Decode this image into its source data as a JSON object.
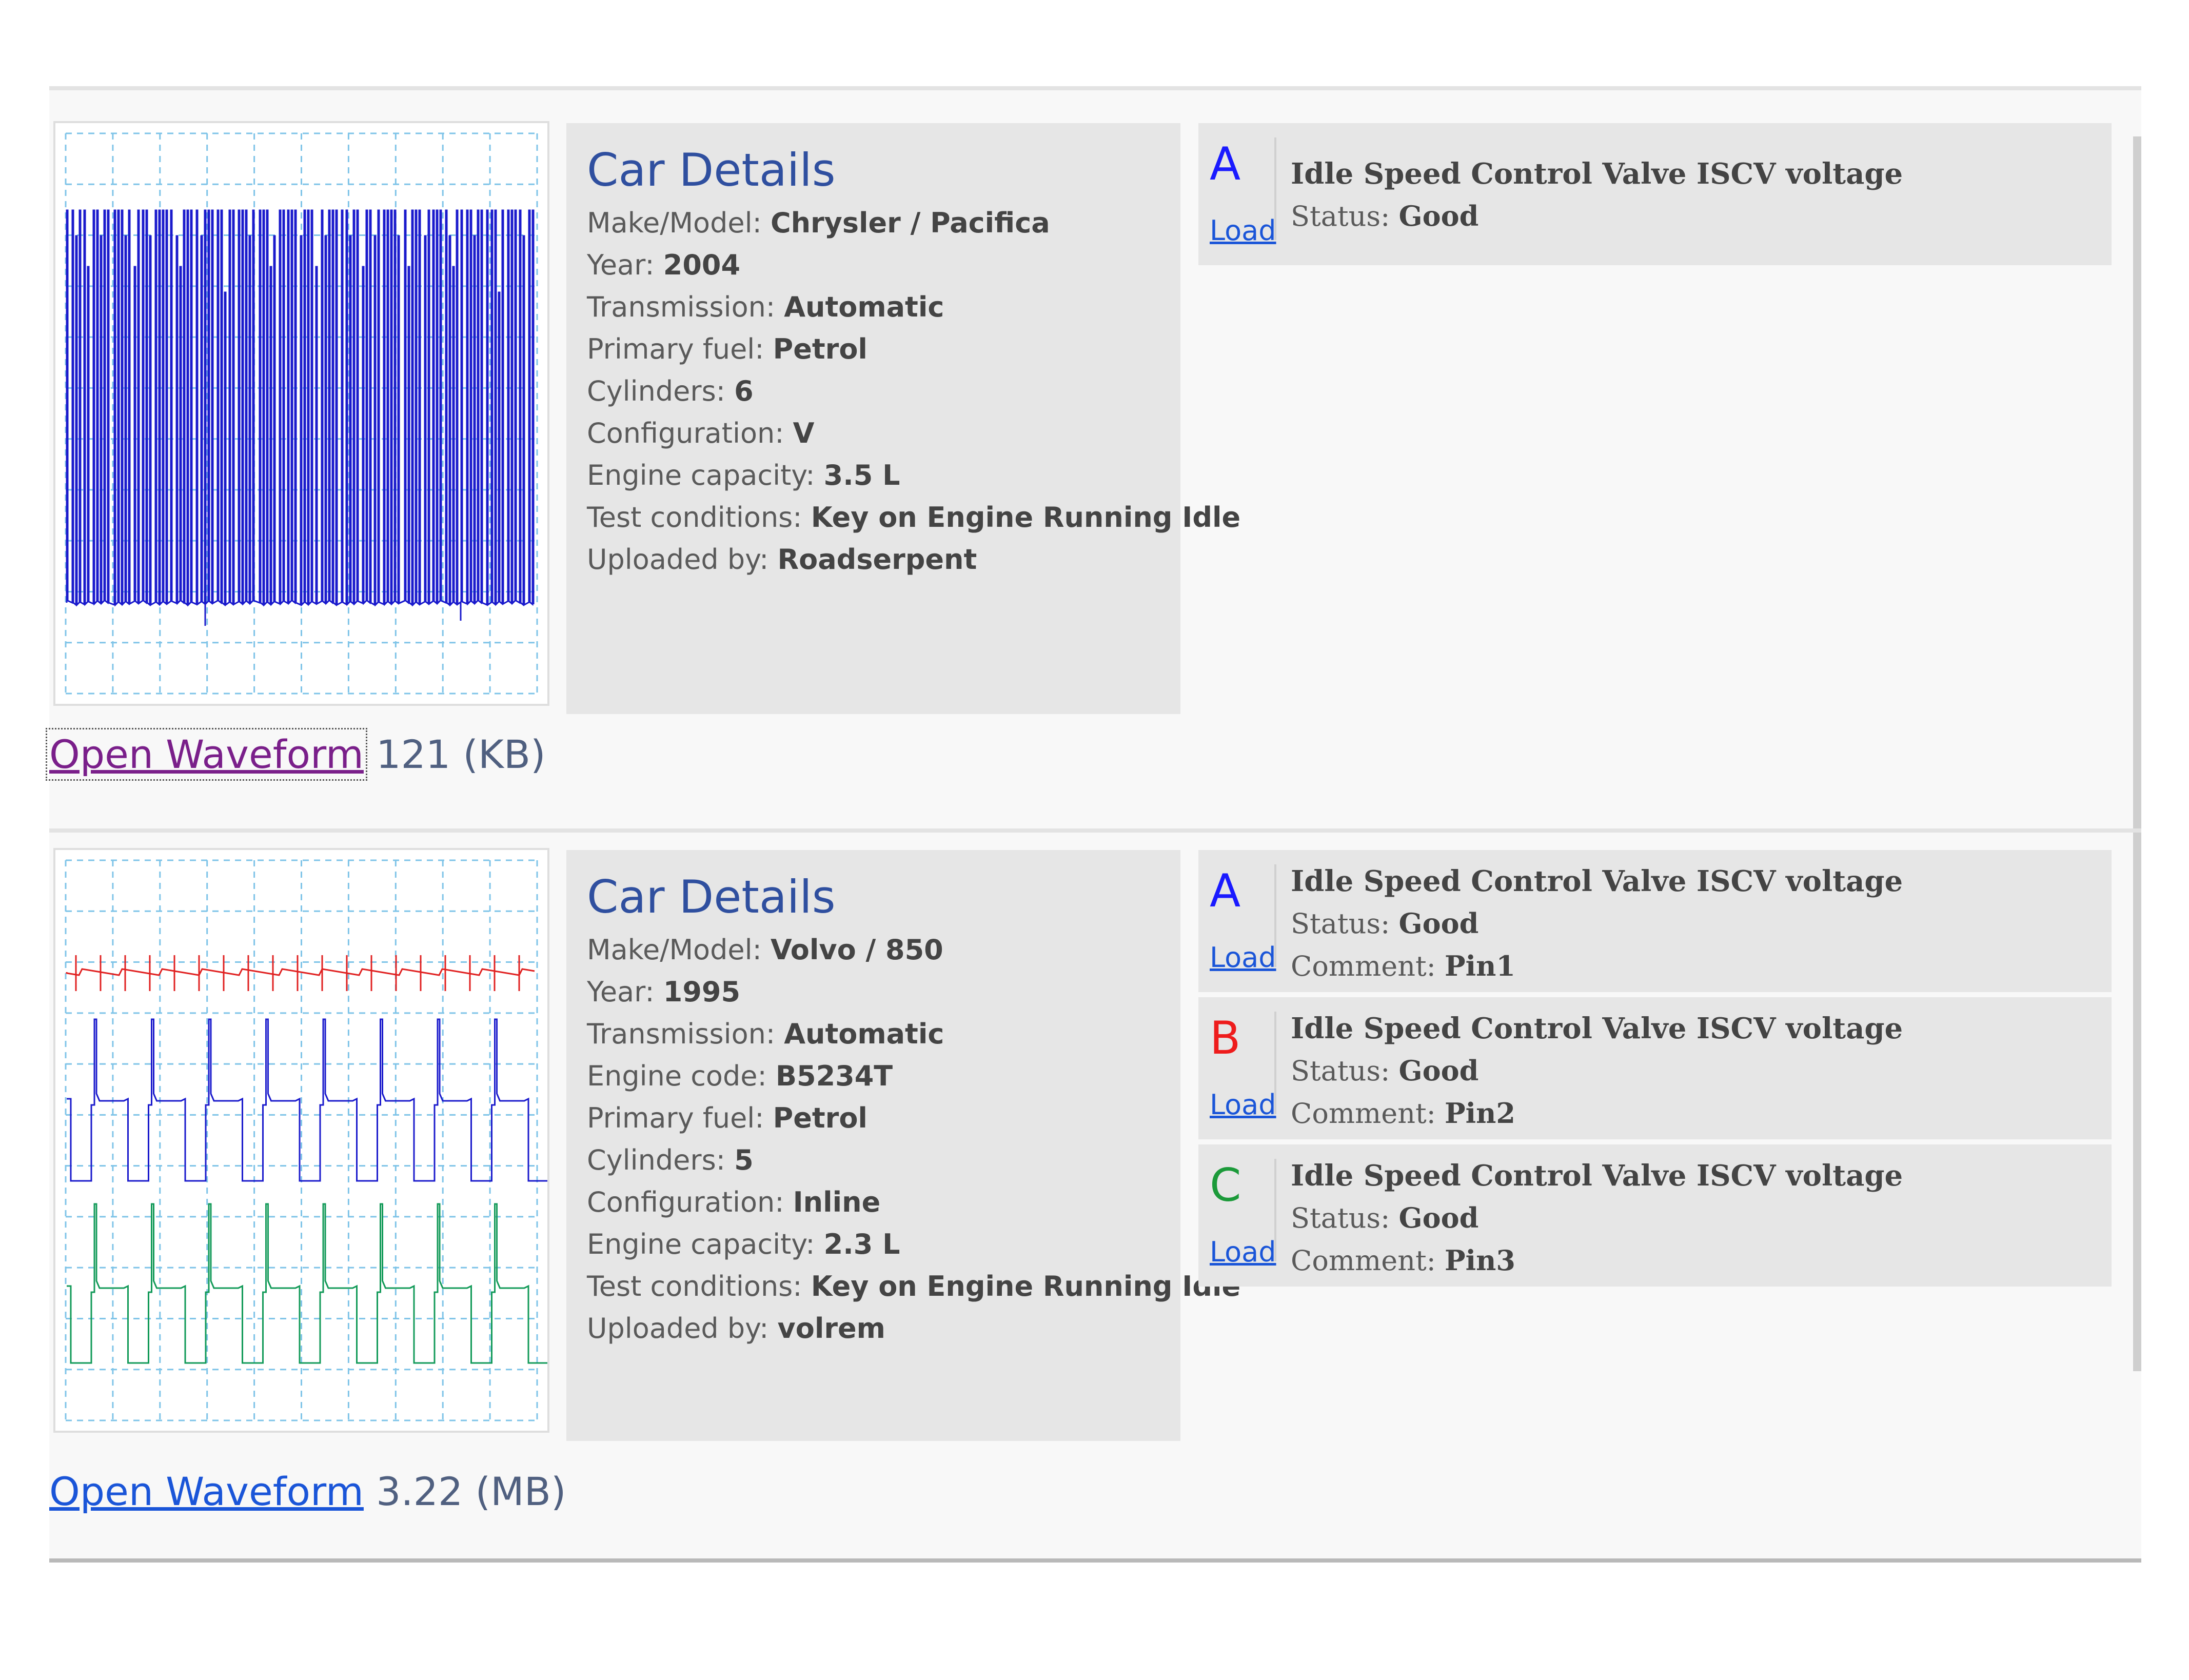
{
  "records": [
    {
      "details_title": "Car Details",
      "fields": [
        {
          "label": "Make/Model:",
          "value": "Chrysler / Pacifica"
        },
        {
          "label": "Year:",
          "value": "2004"
        },
        {
          "label": "Transmission:",
          "value": "Automatic"
        },
        {
          "label": "Primary fuel:",
          "value": "Petrol"
        },
        {
          "label": "Cylinders:",
          "value": "6"
        },
        {
          "label": "Configuration:",
          "value": "V"
        },
        {
          "label": "Engine capacity:",
          "value": "3.5 L"
        },
        {
          "label": "Test conditions:",
          "value": "Key on Engine Running Idle"
        },
        {
          "label": "Uploaded by:",
          "value": "Roadserpent"
        }
      ],
      "channels": [
        {
          "letter": "A",
          "color": "#1a1aff",
          "title": "Idle Speed Control Valve ISCV voltage",
          "status_label": "Status:",
          "status": "Good",
          "load_label": "Load"
        }
      ],
      "open_waveform_label": "Open Waveform",
      "file_size": "121 (KB)",
      "link_color": "#7a1f8a"
    },
    {
      "details_title": "Car Details",
      "fields": [
        {
          "label": "Make/Model:",
          "value": "Volvo / 850"
        },
        {
          "label": "Year:",
          "value": "1995"
        },
        {
          "label": "Transmission:",
          "value": "Automatic"
        },
        {
          "label": "Engine code:",
          "value": "B5234T"
        },
        {
          "label": "Primary fuel:",
          "value": "Petrol"
        },
        {
          "label": "Cylinders:",
          "value": "5"
        },
        {
          "label": "Configuration:",
          "value": "Inline"
        },
        {
          "label": "Engine capacity:",
          "value": "2.3 L"
        },
        {
          "label": "Test conditions:",
          "value": "Key on Engine Running Idle"
        },
        {
          "label": "Uploaded by:",
          "value": "volrem"
        }
      ],
      "channels": [
        {
          "letter": "A",
          "color": "#1a1aff",
          "title": "Idle Speed Control Valve ISCV voltage",
          "status_label": "Status:",
          "status": "Good",
          "comment_label": "Comment:",
          "comment": "Pin1",
          "load_label": "Load"
        },
        {
          "letter": "B",
          "color": "#ee1c1c",
          "title": "Idle Speed Control Valve ISCV voltage",
          "status_label": "Status:",
          "status": "Good",
          "comment_label": "Comment:",
          "comment": "Pin2",
          "load_label": "Load"
        },
        {
          "letter": "C",
          "color": "#1c9a3a",
          "title": "Idle Speed Control Valve ISCV voltage",
          "status_label": "Status:",
          "status": "Good",
          "comment_label": "Comment:",
          "comment": "Pin3",
          "load_label": "Load"
        }
      ],
      "open_waveform_label": "Open Waveform",
      "file_size": "3.22 (MB)",
      "link_color": "#1a55d8"
    }
  ],
  "waveform_colors": {
    "grid": "#7fc4e8",
    "blue": "#1a1acc",
    "red": "#e02020",
    "green": "#129a58"
  }
}
